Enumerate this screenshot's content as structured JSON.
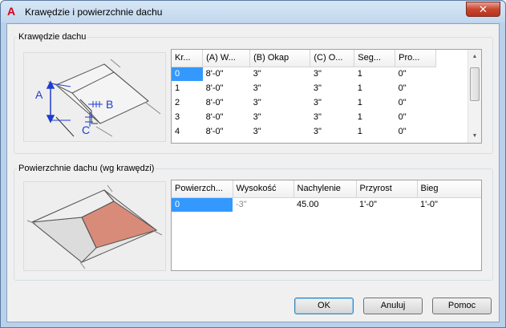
{
  "window": {
    "title": "Krawędzie i powierzchnie dachu",
    "close_label": "✕",
    "app_icon": "A"
  },
  "edges": {
    "group_label": "Krawędzie dachu",
    "illustration_labels": {
      "a": "A",
      "b": "B",
      "c": "C"
    },
    "columns": [
      "Kr...",
      "(A) W...",
      "(B) Okap",
      "(C) O...",
      "Seg...",
      "Pro..."
    ],
    "rows": [
      [
        "0",
        "8'-0\"",
        "3\"",
        "3\"",
        "1",
        "0\""
      ],
      [
        "1",
        "8'-0\"",
        "3\"",
        "3\"",
        "1",
        "0\""
      ],
      [
        "2",
        "8'-0\"",
        "3\"",
        "3\"",
        "1",
        "0\""
      ],
      [
        "3",
        "8'-0\"",
        "3\"",
        "3\"",
        "1",
        "0\""
      ],
      [
        "4",
        "8'-0\"",
        "3\"",
        "3\"",
        "1",
        "0\""
      ]
    ]
  },
  "faces": {
    "group_label": "Powierzchnie dachu (wg krawędzi)",
    "columns": [
      "Powierzch...",
      "Wysokość",
      "Nachylenie",
      "Przyrost",
      "Bieg"
    ],
    "rows": [
      [
        "0",
        "-3\"",
        "45.00",
        "1'-0\"",
        "1'-0\""
      ]
    ]
  },
  "buttons": {
    "ok": "OK",
    "cancel": "Anuluj",
    "help": "Pomoc"
  },
  "colors": {
    "selection": "#3399ff",
    "dimension_blue": "#1f3ccf",
    "roof_face": "#d98b7a"
  }
}
